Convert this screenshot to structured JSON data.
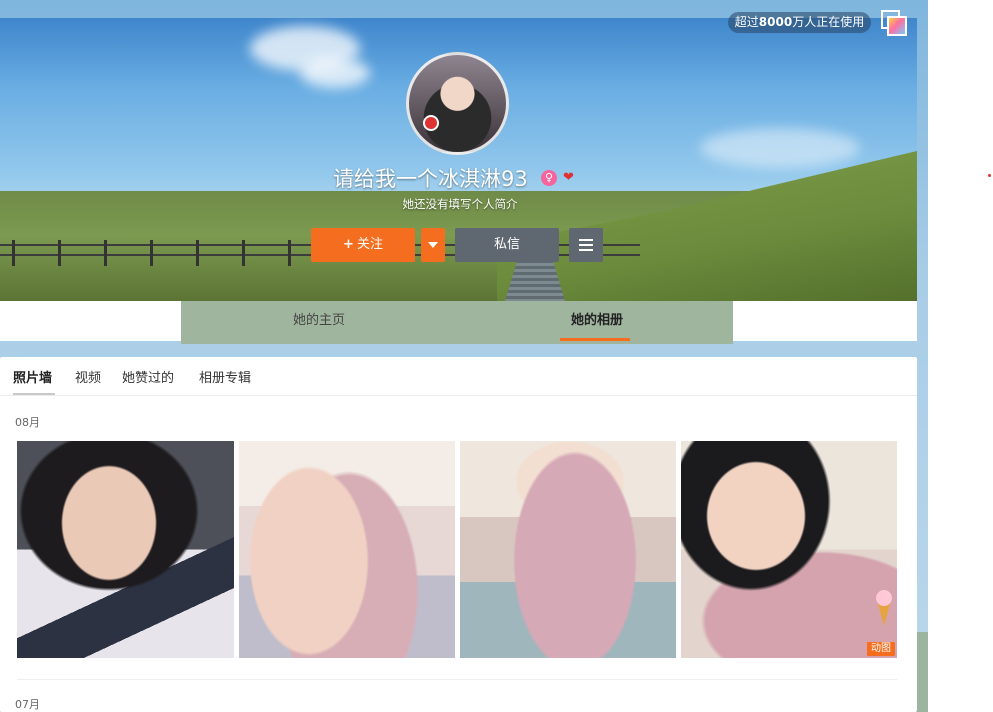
{
  "app_badge": {
    "prefix": "超过",
    "count": "8000",
    "suffix": "万人正在使用"
  },
  "profile": {
    "name": "请给我一个冰淇淋93",
    "bio": "她还没有填写个人简介",
    "gender_icon": "female-icon",
    "vip_icon": "vip-icon"
  },
  "actions": {
    "follow_label": "关注",
    "message_label": "私信"
  },
  "tabs": [
    {
      "label": "她的主页",
      "active": false
    },
    {
      "label": "她的相册",
      "active": true
    }
  ],
  "album": {
    "subtabs": [
      {
        "label": "照片墙",
        "active": true
      },
      {
        "label": "视频",
        "active": false
      },
      {
        "label": "她赞过的",
        "active": false
      },
      {
        "label": "相册专辑",
        "active": false
      }
    ],
    "groups": [
      {
        "month": "08月",
        "photo_count": 4,
        "gif_tag": "动图"
      },
      {
        "month": "07月"
      }
    ]
  },
  "colors": {
    "accent": "#f56e1f",
    "dark_button": "#5f6770",
    "tab_bar": "#9fb59e"
  }
}
